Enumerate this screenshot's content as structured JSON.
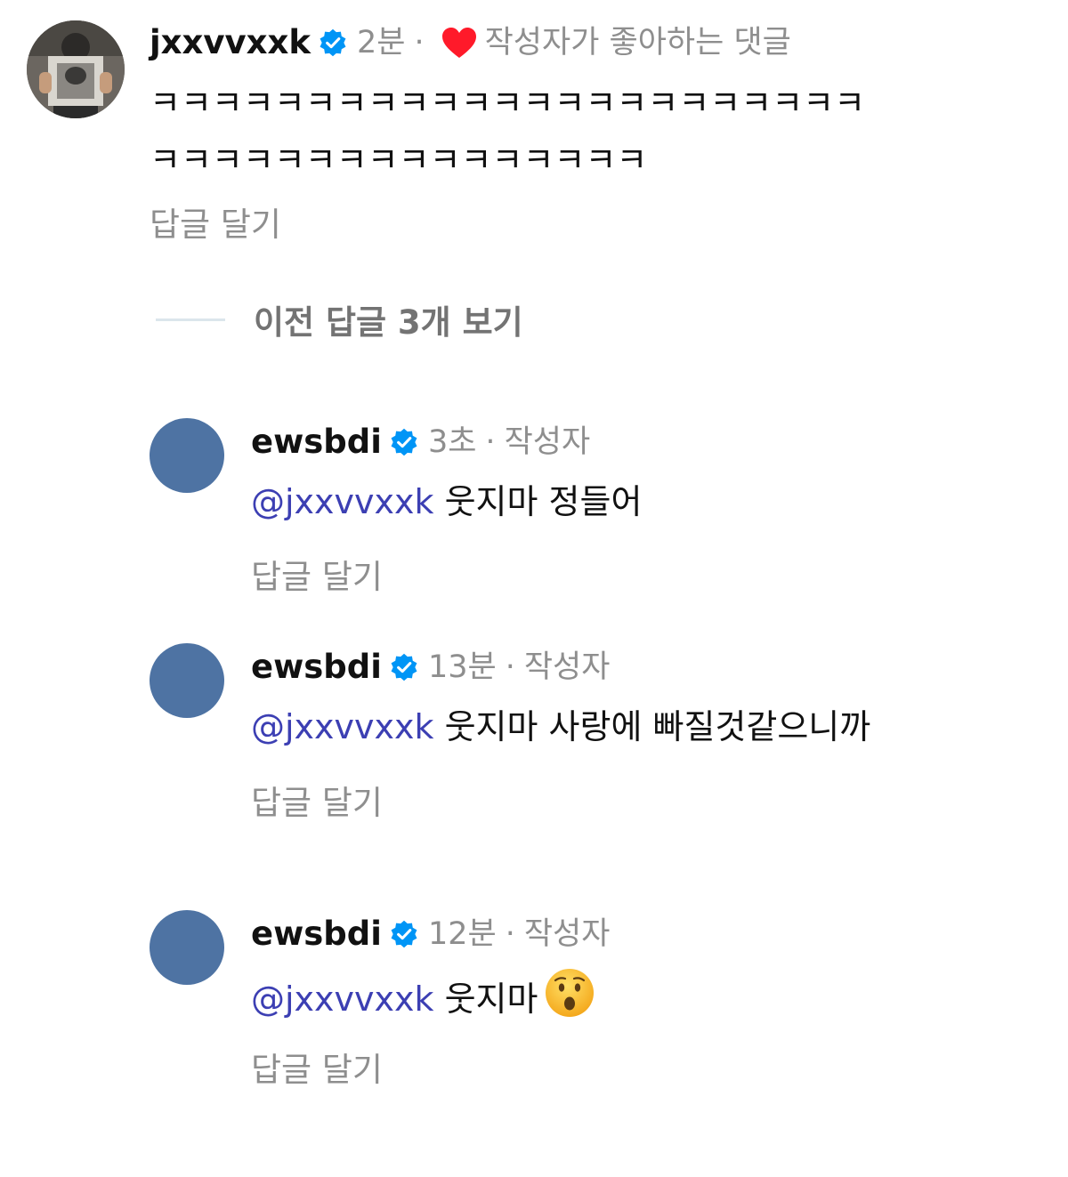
{
  "parent_comment": {
    "username": "jxxvvxxk",
    "verified_icon": "verified-badge-icon",
    "time": "2분",
    "separator": "·",
    "liked_icon": "heart-icon",
    "liked_label": "작성자가 좋아하는 댓글",
    "text_line1": "ㅋㅋㅋㅋㅋㅋㅋㅋㅋㅋㅋㅋㅋㅋㅋㅋㅋㅋㅋㅋㅋㅋㅋ",
    "text_line2": "ㅋㅋㅋㅋㅋㅋㅋㅋㅋㅋㅋㅋㅋㅋㅋㅋ",
    "reply_label": "답글 달기"
  },
  "view_previous_replies": "이전 답글 3개 보기",
  "replies": [
    {
      "username": "ewsbdi",
      "time": "3초",
      "separator": "·",
      "role": "작성자",
      "mention": "@jxxvvxxk",
      "text": " 웃지마 정들어",
      "reply_label": "답글 달기"
    },
    {
      "username": "ewsbdi",
      "time": "13분",
      "separator": "·",
      "role": "작성자",
      "mention": "@jxxvvxxk",
      "text": " 웃지마 사랑에 빠질것같으니까",
      "reply_label": "답글 달기"
    },
    {
      "username": "ewsbdi",
      "time": "12분",
      "separator": "·",
      "role": "작성자",
      "mention": "@jxxvvxxk",
      "text": " 웃지마",
      "emoji": "hushed-face-emoji",
      "reply_label": "답글 달기"
    }
  ],
  "colors": {
    "mention": "#3c3fb3",
    "meta_gray": "#8e8e8e",
    "verified_blue": "#0095f6",
    "heart_red": "#ff1a2a",
    "avatar_blue": "#4e73a3"
  }
}
